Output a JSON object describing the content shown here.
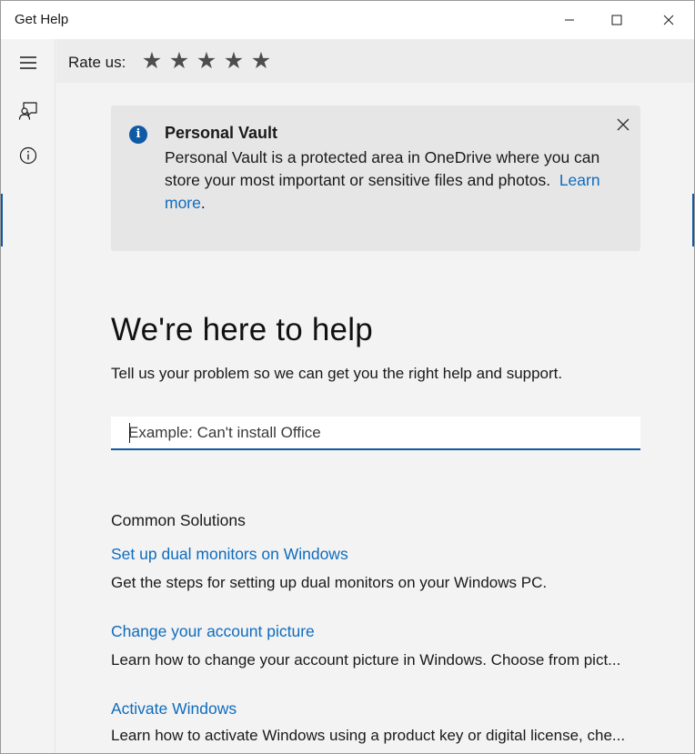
{
  "window": {
    "title": "Get Help",
    "minimize_icon": "minimize-icon",
    "maximize_icon": "maximize-icon",
    "close_icon": "close-icon"
  },
  "nav": {
    "menu_icon": "hamburger-menu-icon",
    "contact_icon": "contact-support-icon",
    "about_icon": "info-circle-icon"
  },
  "header": {
    "rate_label": "Rate us:",
    "star_glyph": "★",
    "stars": [
      "★",
      "★",
      "★",
      "★",
      "★"
    ],
    "rating_selected": 0,
    "rating_max": 5
  },
  "banner": {
    "title": "Personal Vault",
    "text": "Personal Vault is a protected area in OneDrive where you can store your most important or sensitive files and photos.",
    "link_text": "Learn more",
    "link_trailing": ".",
    "info_icon": "info-icon",
    "close_icon": "close-icon"
  },
  "main": {
    "heading": "We're here to help",
    "subtext": "Tell us your problem so we can get you the right help and support.",
    "search_placeholder": "Example: Can't install Office",
    "search_value": ""
  },
  "solutions": {
    "title": "Common Solutions",
    "items": [
      {
        "title": "Set up dual monitors on Windows",
        "description": "Get the steps for setting up dual monitors on your Windows PC."
      },
      {
        "title": "Change your account picture",
        "description": "Learn how to change your account picture in Windows. Choose from pict..."
      },
      {
        "title": "Activate Windows",
        "description": "Learn how to activate Windows using a product key or digital license, che..."
      }
    ]
  },
  "colors": {
    "accent": "#0f5aa5",
    "link": "#0f6cbd",
    "background": "#f3f3f3",
    "banner_bg": "#e6e6e6"
  }
}
